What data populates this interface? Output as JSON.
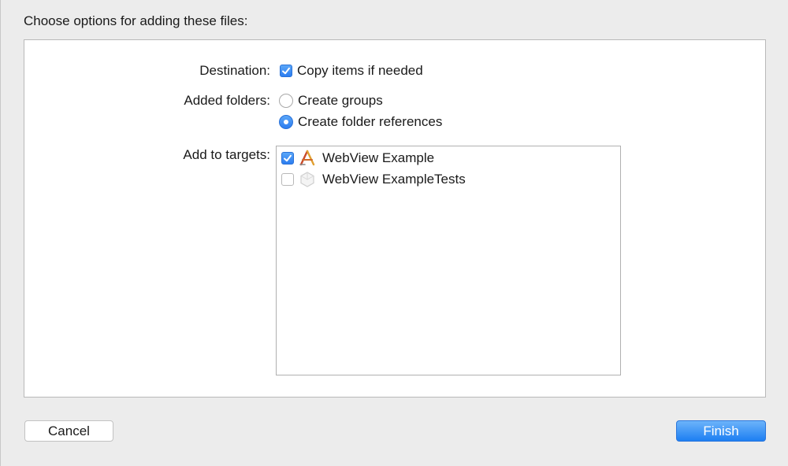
{
  "dialog": {
    "heading": "Choose options for adding these files:"
  },
  "destination": {
    "label": "Destination:",
    "option_label": "Copy items if needed",
    "checked": true
  },
  "added_folders": {
    "label": "Added folders:",
    "options": [
      {
        "label": "Create groups",
        "selected": false
      },
      {
        "label": "Create folder references",
        "selected": true
      }
    ]
  },
  "targets": {
    "label": "Add to targets:",
    "items": [
      {
        "label": "WebView Example",
        "checked": true,
        "icon": "app-target-icon"
      },
      {
        "label": "WebView ExampleTests",
        "checked": false,
        "icon": "test-bundle-icon"
      }
    ]
  },
  "buttons": {
    "cancel_label": "Cancel",
    "finish_label": "Finish"
  },
  "colors": {
    "accent": "#2c7df0",
    "background": "#ececec",
    "panel": "#ffffff"
  }
}
